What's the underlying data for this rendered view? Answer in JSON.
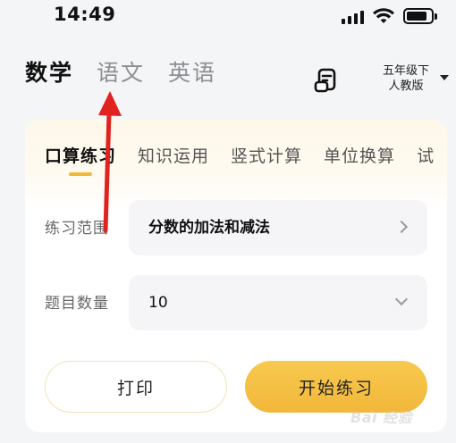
{
  "status_bar": {
    "time": "14:49"
  },
  "subjects": {
    "tabs": [
      "数学",
      "语文",
      "英语"
    ],
    "active": "数学"
  },
  "grade": {
    "line1": "五年级下",
    "line2": "人教版"
  },
  "practice": {
    "tabs": [
      "口算练习",
      "知识运用",
      "竖式计算",
      "单位换算",
      "试"
    ],
    "active": "口算练习"
  },
  "form": {
    "range_label": "练习范围",
    "range_value": "分数的加法和减法",
    "count_label": "题目数量",
    "count_value": "10"
  },
  "buttons": {
    "print": "打印",
    "start": "开始练习"
  },
  "watermark": {
    "text": "Bai 经验"
  },
  "colors": {
    "accent": "#f2b83a",
    "arrow": "#e0231f"
  }
}
